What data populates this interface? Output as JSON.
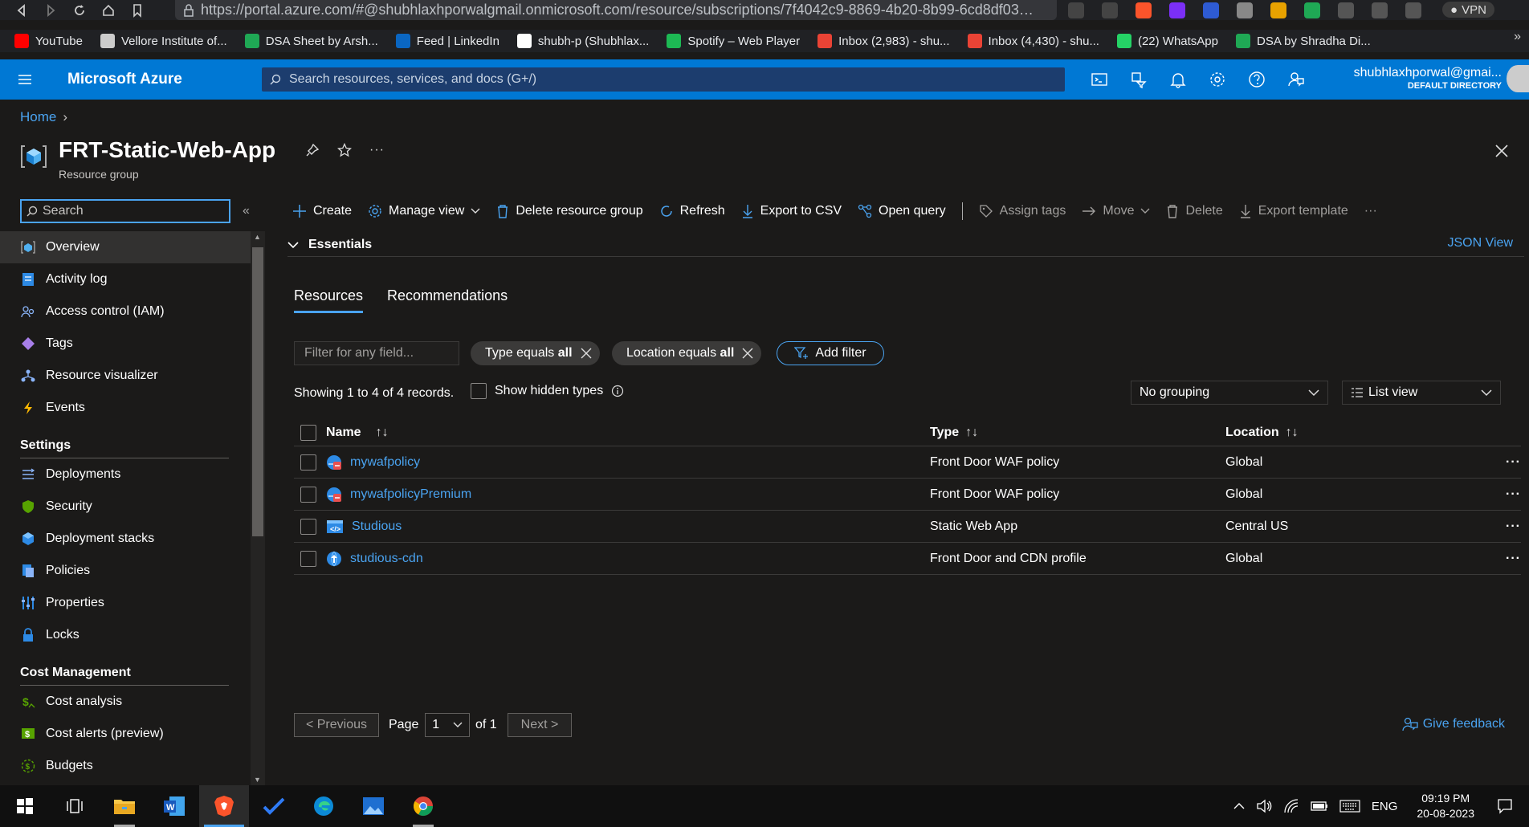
{
  "browser": {
    "url": "https://portal.azure.com/#@shubhlaxhporwalgmail.onmicrosoft.com/resource/subscriptions/7f4042c9-8869-4b20-8b99-6cd8df03f45e...",
    "vpn_label": "VPN",
    "bookmarks": [
      {
        "label": "YouTube",
        "icon": "youtube-icon",
        "color": "#ff0000"
      },
      {
        "label": "Vellore Institute of...",
        "icon": "vit-icon",
        "color": "#cccccc"
      },
      {
        "label": "DSA Sheet by Arsh...",
        "icon": "plus-cross-icon",
        "color": "#1fa855"
      },
      {
        "label": "Feed | LinkedIn",
        "icon": "linkedin-icon",
        "color": "#0a66c2"
      },
      {
        "label": "shubh-p (Shubhlax...",
        "icon": "github-icon",
        "color": "#ffffff"
      },
      {
        "label": "Spotify – Web Player",
        "icon": "spotify-icon",
        "color": "#1db954"
      },
      {
        "label": "Inbox (2,983) - shu...",
        "icon": "gmail-icon",
        "color": "#ea4335"
      },
      {
        "label": "Inbox (4,430) - shu...",
        "icon": "gmail-icon",
        "color": "#ea4335"
      },
      {
        "label": "(22) WhatsApp",
        "icon": "whatsapp-icon",
        "color": "#25d366"
      },
      {
        "label": "DSA by Shradha Di...",
        "icon": "plus-cross-icon",
        "color": "#1fa855"
      }
    ],
    "more": "»"
  },
  "topbar": {
    "brand": "Microsoft Azure",
    "search_placeholder": "Search resources, services, and docs (G+/)",
    "account_email": "shubhlaxhporwal@gmai...",
    "account_directory": "DEFAULT DIRECTORY"
  },
  "header": {
    "breadcrumb_home": "Home",
    "title": "FRT-Static-Web-App",
    "subtitle": "Resource group"
  },
  "left_nav": {
    "search_placeholder": "Search",
    "collapse": "«",
    "items": [
      {
        "label": "Overview",
        "icon": "overview-icon",
        "active": true
      },
      {
        "label": "Activity log",
        "icon": "activity-log-icon"
      },
      {
        "label": "Access control (IAM)",
        "icon": "iam-icon"
      },
      {
        "label": "Tags",
        "icon": "tag-icon"
      },
      {
        "label": "Resource visualizer",
        "icon": "visualizer-icon"
      },
      {
        "label": "Events",
        "icon": "lightning-icon"
      }
    ],
    "settings_title": "Settings",
    "settings_items": [
      {
        "label": "Deployments",
        "icon": "deployments-icon"
      },
      {
        "label": "Security",
        "icon": "shield-icon"
      },
      {
        "label": "Deployment stacks",
        "icon": "stack-icon"
      },
      {
        "label": "Policies",
        "icon": "policy-icon"
      },
      {
        "label": "Properties",
        "icon": "properties-icon"
      },
      {
        "label": "Locks",
        "icon": "lock-icon"
      }
    ],
    "cost_title": "Cost Management",
    "cost_items": [
      {
        "label": "Cost analysis",
        "icon": "cost-analysis-icon"
      },
      {
        "label": "Cost alerts (preview)",
        "icon": "cost-alert-icon"
      },
      {
        "label": "Budgets",
        "icon": "budget-icon"
      }
    ]
  },
  "toolbar": {
    "create": "Create",
    "manage_view": "Manage view",
    "delete_rg": "Delete resource group",
    "refresh": "Refresh",
    "export_csv": "Export to CSV",
    "open_query": "Open query",
    "assign_tags": "Assign tags",
    "move": "Move",
    "delete": "Delete",
    "export_template": "Export template",
    "more": "···"
  },
  "essentials": {
    "label": "Essentials",
    "json_view": "JSON View"
  },
  "tabs": [
    "Resources",
    "Recommendations"
  ],
  "filters": {
    "placeholder": "Filter for any field...",
    "type_prefix": "Type equals",
    "type_value": "all",
    "location_prefix": "Location equals",
    "location_value": "all",
    "add_filter": "Add filter"
  },
  "records": {
    "text": "Showing 1 to 4 of 4 records.",
    "show_hidden": "Show hidden types",
    "grouping": "No grouping",
    "view": "List view"
  },
  "table": {
    "headers": {
      "name": "Name",
      "type": "Type",
      "location": "Location"
    },
    "rows": [
      {
        "name": "mywafpolicy",
        "type": "Front Door WAF policy",
        "location": "Global",
        "icon": "waf-policy-icon"
      },
      {
        "name": "mywafpolicyPremium",
        "type": "Front Door WAF policy",
        "location": "Global",
        "icon": "waf-policy-icon"
      },
      {
        "name": "Studious",
        "type": "Static Web App",
        "location": "Central US",
        "icon": "static-web-app-icon"
      },
      {
        "name": "studious-cdn",
        "type": "Front Door and CDN profile",
        "location": "Global",
        "icon": "cdn-profile-icon"
      }
    ],
    "row_more": "···"
  },
  "pagination": {
    "previous": "< Previous",
    "page_label": "Page",
    "page_value": "1",
    "of": "of 1",
    "next": "Next >"
  },
  "feedback": "Give feedback",
  "taskbar": {
    "language": "ENG",
    "time": "09:19 PM",
    "date": "20-08-2023"
  },
  "colors": {
    "accent": "#0078d4",
    "link": "#4aa3f0",
    "background": "#1b1a19"
  }
}
